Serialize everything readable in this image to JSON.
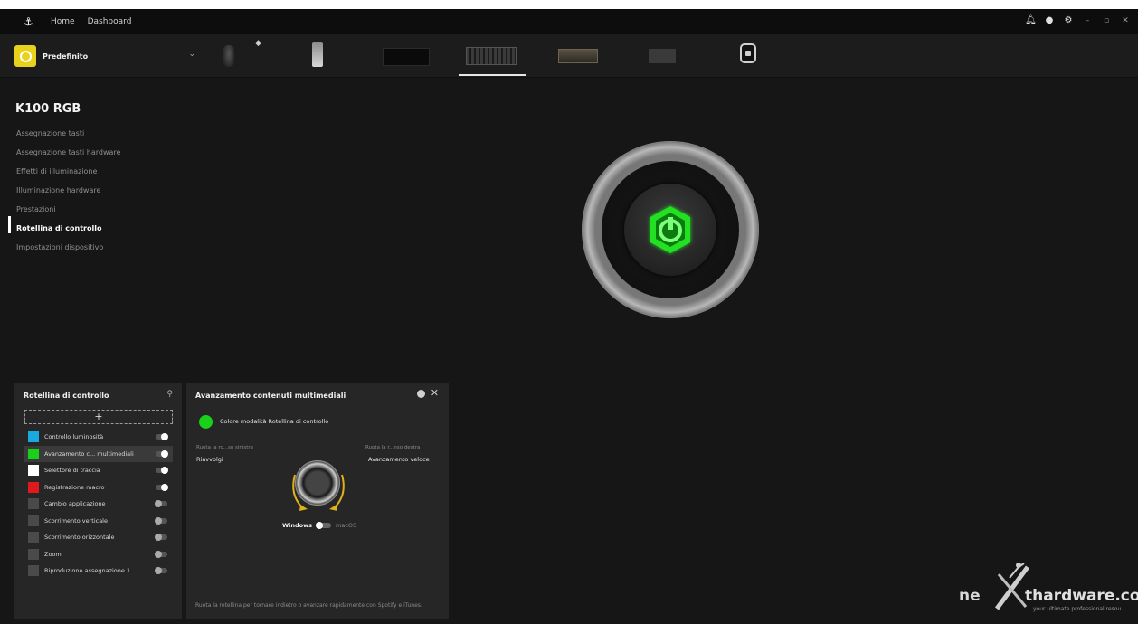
{
  "topbar": {
    "nav": [
      "Home",
      "Dashboard"
    ]
  },
  "profile": {
    "name": "Predefinito",
    "color": "#e8d21b"
  },
  "device": {
    "title": "K100 RGB"
  },
  "menu": {
    "items": [
      {
        "label": "Assegnazione tasti",
        "active": false
      },
      {
        "label": "Assegnazione tasti hardware",
        "active": false
      },
      {
        "label": "Effetti di illuminazione",
        "active": false
      },
      {
        "label": "Illuminazione hardware",
        "active": false
      },
      {
        "label": "Prestazioni",
        "active": false
      },
      {
        "label": "Rotellina di controllo",
        "active": true
      },
      {
        "label": "Impostazioni dispositivo",
        "active": false
      }
    ]
  },
  "list_panel": {
    "title": "Rotellina di controllo",
    "add_label": "+",
    "items": [
      {
        "label": "Controllo luminosità",
        "color": "#19a8e0",
        "on": true,
        "selected": false
      },
      {
        "label": "Avanzamento c... multimediali",
        "color": "#1ad11a",
        "on": true,
        "selected": true
      },
      {
        "label": "Selettore di traccia",
        "color": "#ffffff",
        "on": true,
        "selected": false
      },
      {
        "label": "Registrazione macro",
        "color": "#e01a1a",
        "on": true,
        "selected": false
      },
      {
        "label": "Cambio applicazione",
        "color": "#4a4a4a",
        "on": false,
        "selected": false
      },
      {
        "label": "Scorrimento verticale",
        "color": "#4a4a4a",
        "on": false,
        "selected": false
      },
      {
        "label": "Scorrimento orizzontale",
        "color": "#4a4a4a",
        "on": false,
        "selected": false
      },
      {
        "label": "Zoom",
        "color": "#4a4a4a",
        "on": false,
        "selected": false
      },
      {
        "label": "Riproduzione assegnazione 1",
        "color": "#4a4a4a",
        "on": false,
        "selected": false
      }
    ]
  },
  "detail": {
    "title": "Avanzamento contenuti multimediali",
    "color_label": "Colore modalità Rotellina di controllo",
    "accent": "#1ad11a",
    "left_caption": "Ruota la ro...so sinistra",
    "left_value": "Riavvolgi",
    "right_caption": "Ruota la r...nso destra",
    "right_value": "Avanzamento veloce",
    "os_left": "Windows",
    "os_right": "macOS",
    "description": "Ruota la rotellina per tornare indietro o avanzare rapidamente con Spotify e iTunes."
  },
  "watermark": {
    "prefix": "ne",
    "brand": "thardware.com",
    "tagline": "your ultimate professional resou"
  }
}
